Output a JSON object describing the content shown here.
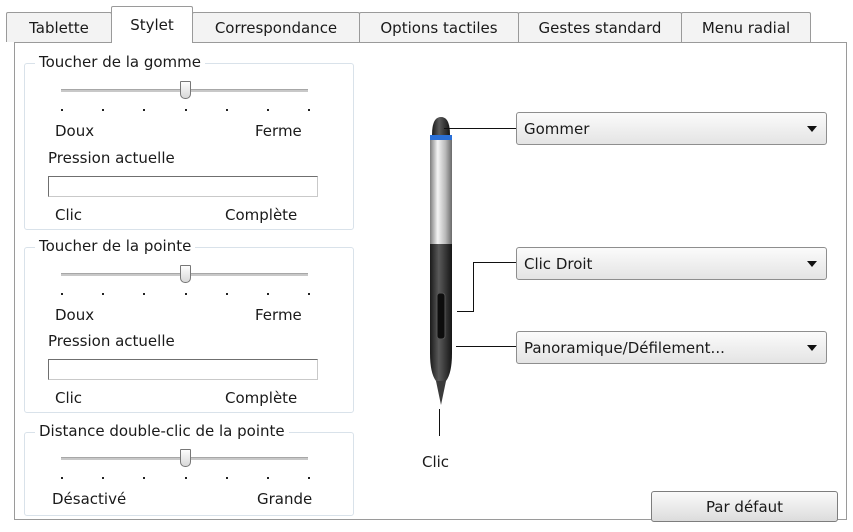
{
  "tabs": [
    {
      "label": "Tablette",
      "active": false
    },
    {
      "label": "Stylet",
      "active": true
    },
    {
      "label": "Correspondance",
      "active": false
    },
    {
      "label": "Options tactiles",
      "active": false
    },
    {
      "label": "Gestes standard",
      "active": false
    },
    {
      "label": "Menu radial",
      "active": false
    }
  ],
  "eraser_feel": {
    "title": "Toucher de la gomme",
    "min_label": "Doux",
    "max_label": "Ferme",
    "pressure_label": "Pression actuelle",
    "click_label": "Clic",
    "full_label": "Complète",
    "level": 0.5
  },
  "tip_feel": {
    "title": "Toucher de la pointe",
    "min_label": "Doux",
    "max_label": "Ferme",
    "pressure_label": "Pression actuelle",
    "click_label": "Clic",
    "full_label": "Complète",
    "level": 0.5
  },
  "double_click": {
    "title": "Distance double-clic de la pointe",
    "min_label": "Désactivé",
    "max_label": "Grande",
    "level": 0.5
  },
  "pen": {
    "eraser_action": "Gommer",
    "upper_button_action": "Clic Droit",
    "lower_button_action": "Panoramique/Défilement...",
    "tip_label": "Clic",
    "accent_color": "#2a6fd6"
  },
  "default_button": "Par défaut"
}
